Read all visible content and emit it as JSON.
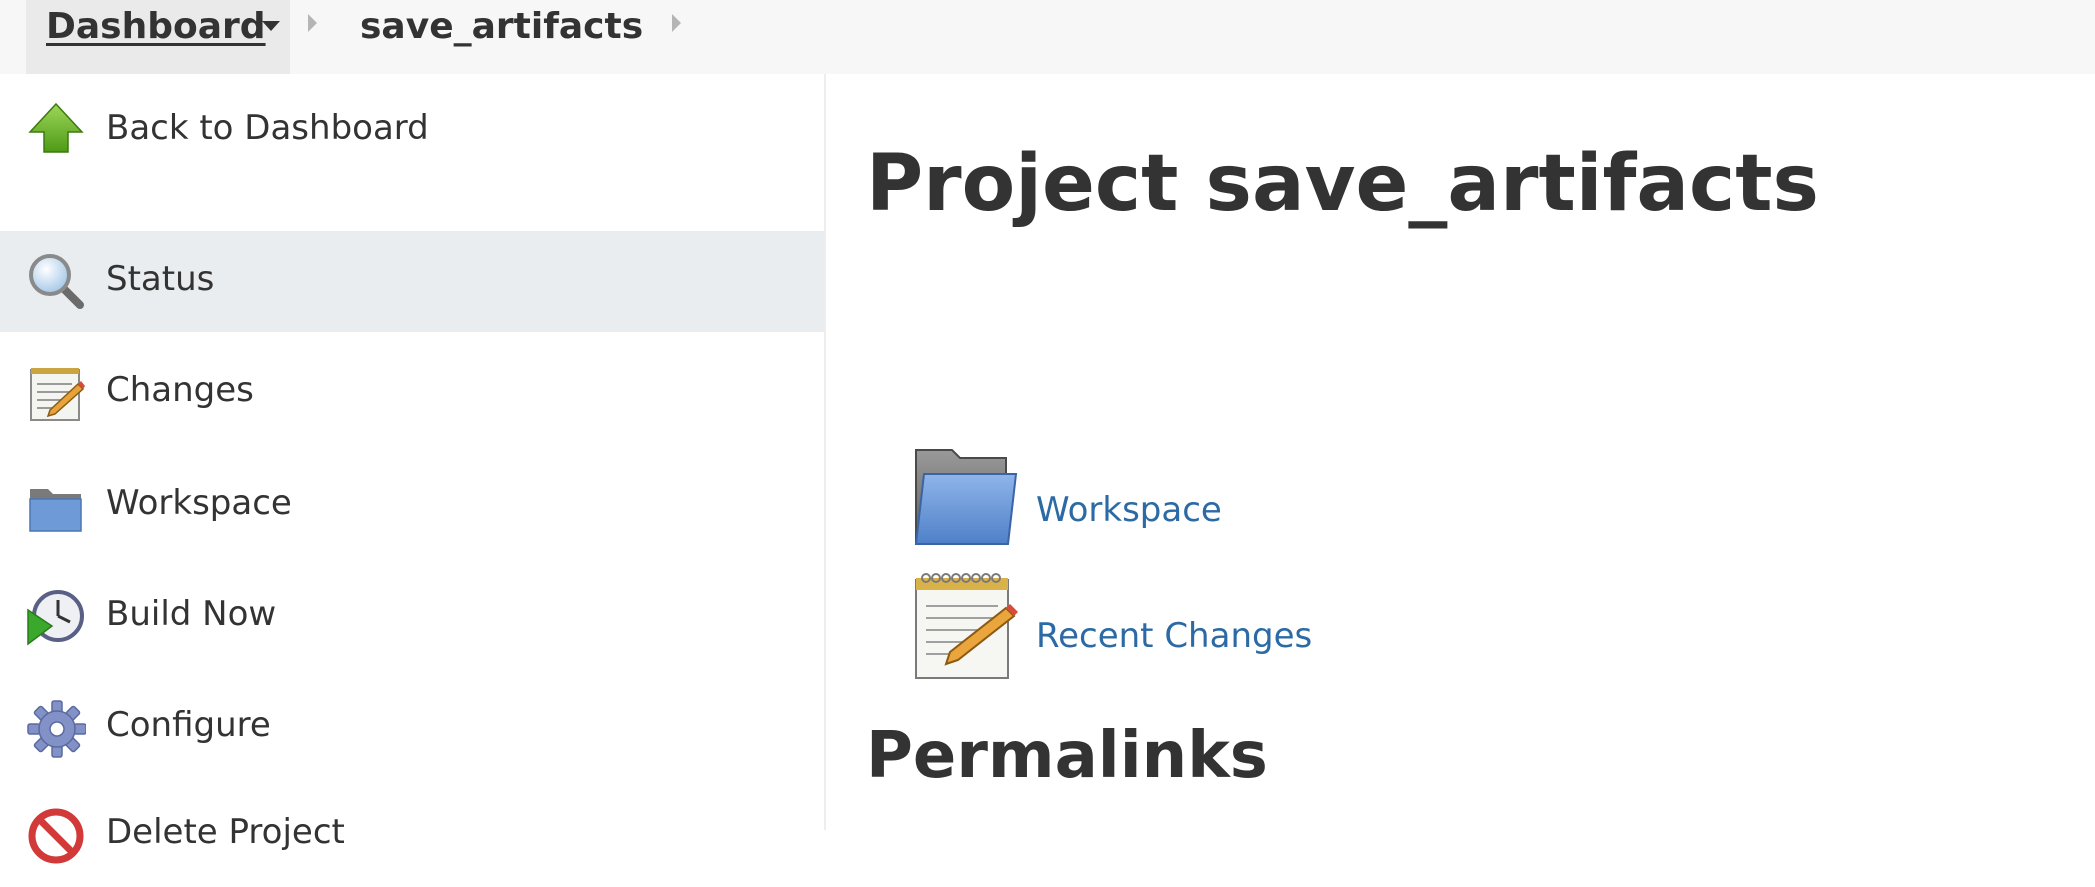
{
  "breadcrumb": {
    "dashboard_label": "Dashboard",
    "project_label": "save_artifacts"
  },
  "sidebar": {
    "items": [
      {
        "label": "Back to Dashboard",
        "icon": "up-arrow-icon"
      },
      {
        "label": "Status",
        "icon": "magnifier-icon",
        "active": true
      },
      {
        "label": "Changes",
        "icon": "notepad-icon"
      },
      {
        "label": "Workspace",
        "icon": "folder-icon"
      },
      {
        "label": "Build Now",
        "icon": "clock-play-icon"
      },
      {
        "label": "Configure",
        "icon": "gear-icon"
      },
      {
        "label": "Delete Project",
        "icon": "delete-icon"
      }
    ]
  },
  "main": {
    "title": "Project save_artifacts",
    "links": [
      {
        "label": "Workspace",
        "icon": "folder-icon"
      },
      {
        "label": "Recent Changes",
        "icon": "notepad-icon"
      }
    ],
    "permalinks_heading": "Permalinks"
  },
  "colors": {
    "link": "#2c6aa5",
    "text": "#333333",
    "sidebar_active": "#e9edf0",
    "breadcrumb_bg": "#f7f7f7"
  }
}
